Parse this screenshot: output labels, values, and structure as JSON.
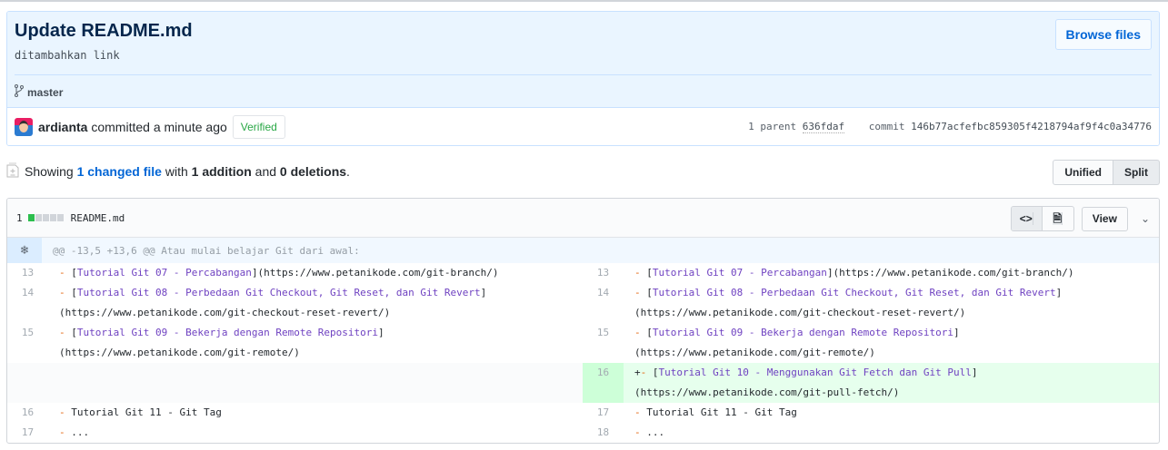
{
  "commit": {
    "title": "Update README.md",
    "message": "ditambahkan link",
    "branch": "master",
    "browse_label": "Browse files",
    "author": "ardianta",
    "committed": "committed a minute ago",
    "verified": "Verified",
    "parent_label": "1 parent",
    "parent_sha": "636fdaf",
    "commit_label": "commit",
    "commit_sha": "146b77acfefbc859305f4218794af9f4c0a34776"
  },
  "toc": {
    "showing": "Showing",
    "changed": "1 changed file",
    "with": "with",
    "additions": "1 addition",
    "and": "and",
    "deletions": "0 deletions",
    "dot": "."
  },
  "view_toggle": {
    "unified": "Unified",
    "split": "Split",
    "selected": "Split"
  },
  "file": {
    "changes": "1",
    "name": "README.md",
    "view_label": "View",
    "diffstat": [
      1,
      0,
      0,
      0,
      0
    ],
    "hunk": "@@ -13,5 +13,6 @@ Atau mulai belajar Git dari awal:",
    "rows": [
      {
        "left": {
          "num": "13",
          "tokens": [
            [
              "dash",
              "- "
            ],
            [
              "plain",
              "["
            ],
            [
              "link",
              "Tutorial Git 07 - Percabangan"
            ],
            [
              "plain",
              "](https://www.petanikode.com/git-branch/)"
            ]
          ]
        },
        "right": {
          "num": "13",
          "tokens": [
            [
              "dash",
              "- "
            ],
            [
              "plain",
              "["
            ],
            [
              "link",
              "Tutorial Git 07 - Percabangan"
            ],
            [
              "plain",
              "](https://www.petanikode.com/git-branch/)"
            ]
          ]
        }
      },
      {
        "left": {
          "num": "14",
          "tokens": [
            [
              "dash",
              "- "
            ],
            [
              "plain",
              "["
            ],
            [
              "link",
              "Tutorial Git 08 - Perbedaan Git Checkout, Git Reset, dan Git Revert"
            ],
            [
              "plain",
              "]"
            ],
            [
              "nl",
              ""
            ],
            [
              "plain",
              "(https://www.petanikode.com/git-checkout-reset-revert/)"
            ]
          ]
        },
        "right": {
          "num": "14",
          "tokens": [
            [
              "dash",
              "- "
            ],
            [
              "plain",
              "["
            ],
            [
              "link",
              "Tutorial Git 08 - Perbedaan Git Checkout, Git Reset, dan Git Revert"
            ],
            [
              "plain",
              "]"
            ],
            [
              "nl",
              ""
            ],
            [
              "plain",
              "(https://www.petanikode.com/git-checkout-reset-revert/)"
            ]
          ]
        }
      },
      {
        "left": {
          "num": "15",
          "tokens": [
            [
              "dash",
              "- "
            ],
            [
              "plain",
              "["
            ],
            [
              "link",
              "Tutorial Git 09 - Bekerja dengan Remote Repositori"
            ],
            [
              "plain",
              "]"
            ],
            [
              "nl",
              ""
            ],
            [
              "plain",
              "(https://www.petanikode.com/git-remote/)"
            ]
          ]
        },
        "right": {
          "num": "15",
          "tokens": [
            [
              "dash",
              "- "
            ],
            [
              "plain",
              "["
            ],
            [
              "link",
              "Tutorial Git 09 - Bekerja dengan Remote Repositori"
            ],
            [
              "plain",
              "]"
            ],
            [
              "nl",
              ""
            ],
            [
              "plain",
              "(https://www.petanikode.com/git-remote/)"
            ]
          ]
        }
      },
      {
        "left": null,
        "right": {
          "num": "16",
          "add": true,
          "tokens": [
            [
              "plain",
              "+"
            ],
            [
              "dash",
              "- "
            ],
            [
              "plain",
              "["
            ],
            [
              "link",
              "Tutorial Git 10 - Menggunakan Git Fetch dan Git Pull"
            ],
            [
              "plain",
              "]"
            ],
            [
              "nl",
              ""
            ],
            [
              "plain",
              "(https://www.petanikode.com/git-pull-fetch/)"
            ]
          ]
        }
      },
      {
        "left": {
          "num": "16",
          "tokens": [
            [
              "dash",
              "- "
            ],
            [
              "plain",
              "Tutorial Git 11 - Git Tag"
            ]
          ]
        },
        "right": {
          "num": "17",
          "tokens": [
            [
              "dash",
              "- "
            ],
            [
              "plain",
              "Tutorial Git 11 - Git Tag"
            ]
          ]
        }
      },
      {
        "left": {
          "num": "17",
          "tokens": [
            [
              "dash",
              "- "
            ],
            [
              "plain",
              "..."
            ]
          ]
        },
        "right": {
          "num": "18",
          "tokens": [
            [
              "dash",
              "- "
            ],
            [
              "plain",
              "..."
            ]
          ]
        }
      }
    ]
  },
  "colors": {
    "added_bg": "#e6ffed",
    "added_num_bg": "#cdffd8",
    "link": "#0366d6",
    "verified": "#28a745"
  }
}
